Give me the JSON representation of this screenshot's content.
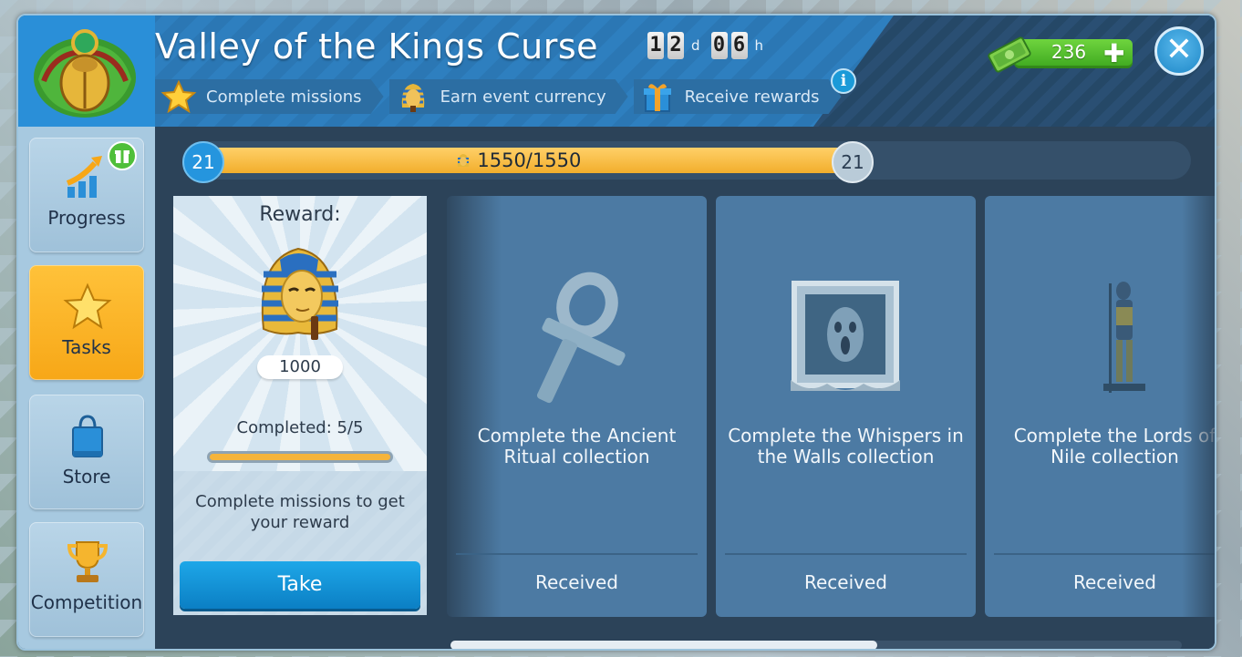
{
  "header": {
    "title": "Valley of the Kings Curse",
    "timer": {
      "days_digits": [
        "1",
        "2"
      ],
      "days_unit": "d",
      "hours_digits": [
        "0",
        "6"
      ],
      "hours_unit": "h"
    },
    "steps": [
      {
        "label": "Complete missions",
        "icon": "star-icon"
      },
      {
        "label": "Earn event currency",
        "icon": "pharaoh-mask-icon"
      },
      {
        "label": "Receive rewards",
        "icon": "gift-icon"
      }
    ],
    "info_icon": "i",
    "currency": {
      "value": "236",
      "icon": "money-icon"
    },
    "close": "✕"
  },
  "sidebar": {
    "items": [
      {
        "label": "Progress",
        "icon": "growth-chart-icon"
      },
      {
        "label": "Tasks",
        "icon": "star-icon",
        "active": true
      },
      {
        "label": "Store",
        "icon": "shopping-bag-icon"
      },
      {
        "label": "Competition",
        "icon": "trophy-icon"
      }
    ]
  },
  "progress": {
    "level_start": "21",
    "level_end": "21",
    "text": "1550/1550",
    "fraction": 1.0
  },
  "reward": {
    "title": "Reward:",
    "amount": "1000",
    "completed": "Completed: 5/5",
    "completed_fraction": 1.0,
    "note": "Complete missions to get your reward",
    "take_label": "Take"
  },
  "cards": [
    {
      "title": "Complete the Ancient Ritual collection",
      "status": "Received",
      "icon": "ankh-icon"
    },
    {
      "title": "Complete the Whispers in the Walls collection",
      "status": "Received",
      "icon": "ghost-frame-icon"
    },
    {
      "title": "Complete the Lords of Nile collection",
      "status": "Received",
      "icon": "anubis-statue-icon"
    }
  ],
  "colors": {
    "accent_blue": "#2595de",
    "active_tab": "#f7a717",
    "progress_fill": "#f2ae2c",
    "currency_green": "#3da81f"
  }
}
